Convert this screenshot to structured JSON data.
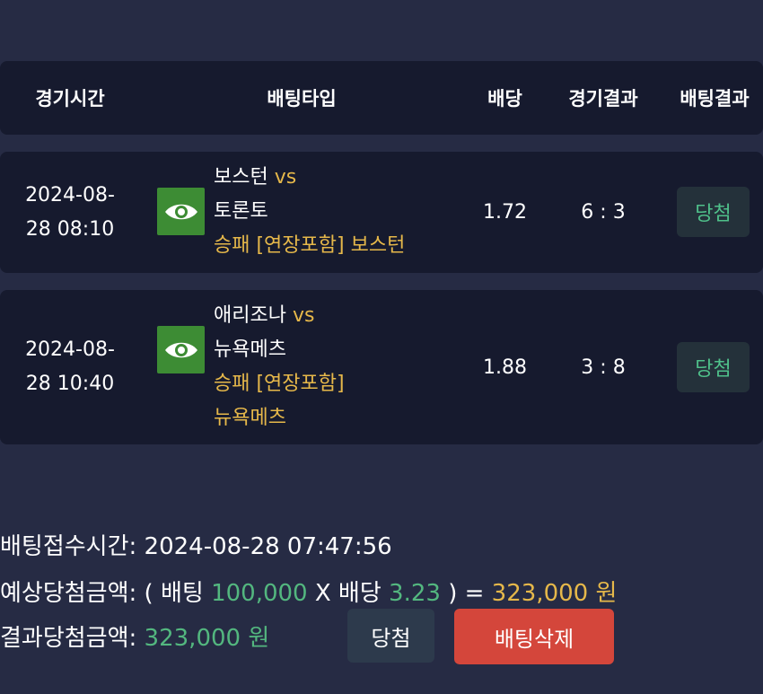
{
  "table": {
    "headers": {
      "time": "경기시간",
      "bet_type": "배팅타입",
      "odds": "배당",
      "game_result": "경기결과",
      "bet_result": "배팅결과"
    },
    "rows": [
      {
        "time_date": "2024-08-",
        "time_clock": "28 08:10",
        "icon": "eye-icon",
        "home": "보스턴",
        "vs": "vs",
        "away": "토론토",
        "pick_line1": "승패 [연장포함] 보스턴",
        "pick_line2": "",
        "odds": "1.72",
        "score": "6 : 3",
        "result": "당첨"
      },
      {
        "time_date": "2024-08-",
        "time_clock": "28 10:40",
        "icon": "eye-icon",
        "home": "애리조나",
        "vs": "vs",
        "away": "뉴욕메츠",
        "pick_line1": "승패 [연장포함]",
        "pick_line2": "뉴욕메츠",
        "odds": "1.88",
        "score": "3 : 8",
        "result": "당첨"
      }
    ]
  },
  "summary": {
    "received_label": "배팅접수시간:",
    "received_value": "2024-08-28 07:47:56",
    "expected_label": "예상당첨금액:",
    "expected_open": "( 배팅",
    "expected_stake": "100,000",
    "expected_mult": "X 배당",
    "expected_odds": "3.23",
    "expected_close": ") =",
    "expected_amount": "323,000 원",
    "result_label": "결과당첨금액:",
    "result_amount": "323,000 원",
    "win_button": "당첨",
    "delete_button": "배팅삭제"
  },
  "colors": {
    "background": "#262b44",
    "panel": "#161a2e",
    "accent_yellow": "#e6b84a",
    "accent_green": "#53b77f",
    "icon_green": "#3d8c34",
    "delete_red": "#d4463b"
  }
}
